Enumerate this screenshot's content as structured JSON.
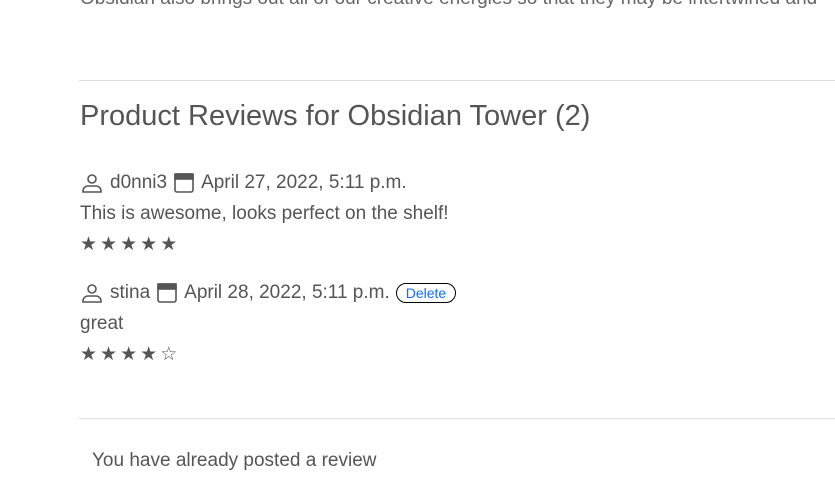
{
  "description_tail": "Obsidian also brings out all of our creative energies so that they may be intertwined and",
  "reviews_title": "Product Reviews for Obsidian Tower (2)",
  "reviews": [
    {
      "user": "d0nni3",
      "date": "April 27, 2022, 5:11 p.m.",
      "text": "This is awesome, looks perfect on the shelf!",
      "rating": 5
    },
    {
      "user": "stina",
      "date": "April 28, 2022, 5:11 p.m.",
      "text": "great",
      "rating": 4,
      "delete_label": "Delete"
    }
  ],
  "already_posted": "You have already posted a review",
  "colors": {
    "link": "#0d6efd",
    "text": "#555555"
  }
}
